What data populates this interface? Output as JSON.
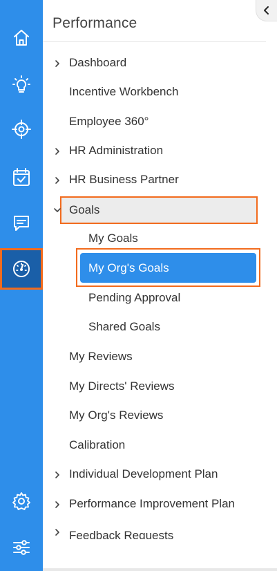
{
  "panel": {
    "title": "Performance",
    "collapse_icon": "chevron-left-icon"
  },
  "rail": {
    "items": [
      {
        "name": "home",
        "icon": "home-icon",
        "active": false
      },
      {
        "name": "ideas",
        "icon": "lightbulb-icon",
        "active": false
      },
      {
        "name": "targets",
        "icon": "target-icon",
        "active": false
      },
      {
        "name": "calendar",
        "icon": "calendar-check-icon",
        "active": false
      },
      {
        "name": "feedback",
        "icon": "message-icon",
        "active": false
      },
      {
        "name": "performance",
        "icon": "gauge-icon",
        "active": true
      },
      {
        "name": "settings",
        "icon": "gear-icon",
        "active": false
      },
      {
        "name": "filters",
        "icon": "sliders-icon",
        "active": false
      }
    ],
    "accent": "#2e8eea",
    "active_bg": "#1a5fa8",
    "highlight": "#f26b1d"
  },
  "menu": {
    "dashboard": "Dashboard",
    "incentive_workbench": "Incentive Workbench",
    "employee_360": "Employee 360°",
    "hr_administration": "HR Administration",
    "hr_business_partner": "HR Business Partner",
    "goals": "Goals",
    "my_goals": "My Goals",
    "my_orgs_goals": "My Org's Goals",
    "pending_approval": "Pending Approval",
    "shared_goals": "Shared Goals",
    "my_reviews": "My Reviews",
    "my_directs_reviews": "My Directs' Reviews",
    "my_orgs_reviews": "My Org's Reviews",
    "calibration": "Calibration",
    "individual_development_plan": "Individual Development Plan",
    "performance_improvement_plan": "Performance Improvement Plan",
    "feedback_requests": "Feedback Requests"
  }
}
